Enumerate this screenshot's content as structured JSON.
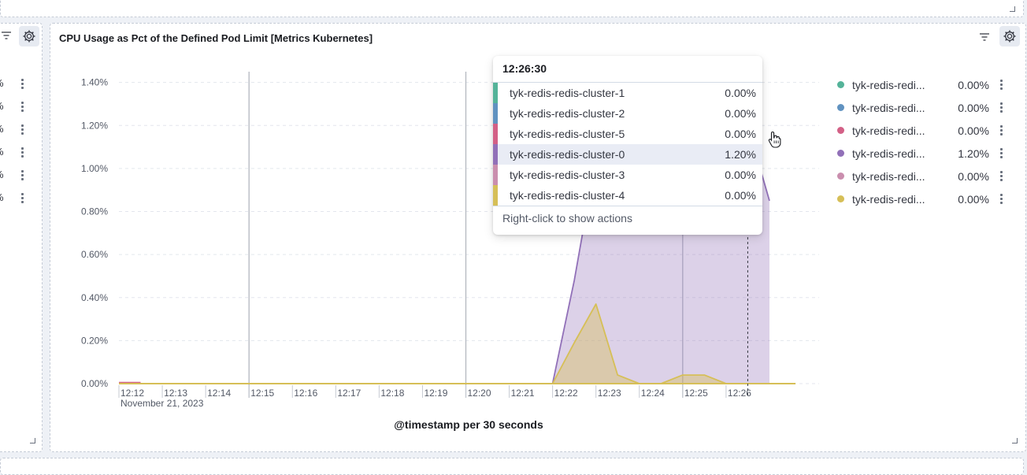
{
  "panel": {
    "title": "CPU Usage as Pct of the Defined Pod Limit [Metrics Kubernetes]"
  },
  "left_panel": {
    "values": [
      "%",
      "%",
      "%",
      "%",
      "%",
      "%"
    ]
  },
  "tooltip": {
    "time": "12:26:30",
    "rows": [
      {
        "name": "tyk-redis-redis-cluster-1",
        "value": "0.00%",
        "color": "#54b399"
      },
      {
        "name": "tyk-redis-redis-cluster-2",
        "value": "0.00%",
        "color": "#6092c0"
      },
      {
        "name": "tyk-redis-redis-cluster-5",
        "value": "0.00%",
        "color": "#d36086"
      },
      {
        "name": "tyk-redis-redis-cluster-0",
        "value": "1.20%",
        "color": "#9170b8",
        "highlighted": true
      },
      {
        "name": "tyk-redis-redis-cluster-3",
        "value": "0.00%",
        "color": "#ca8eae"
      },
      {
        "name": "tyk-redis-redis-cluster-4",
        "value": "0.00%",
        "color": "#d6bf57"
      }
    ],
    "footer": "Right-click to show actions"
  },
  "legend": [
    {
      "label": "tyk-redis-redi...",
      "value": "0.00%",
      "color": "#54b399"
    },
    {
      "label": "tyk-redis-redi...",
      "value": "0.00%",
      "color": "#6092c0"
    },
    {
      "label": "tyk-redis-redi...",
      "value": "0.00%",
      "color": "#d36086"
    },
    {
      "label": "tyk-redis-redi...",
      "value": "1.20%",
      "color": "#9170b8"
    },
    {
      "label": "tyk-redis-redi...",
      "value": "0.00%",
      "color": "#ca8eae"
    },
    {
      "label": "tyk-redis-redi...",
      "value": "0.00%",
      "color": "#d6bf57"
    }
  ],
  "chart_data": {
    "type": "area",
    "xlabel": "@timestamp per 30 seconds",
    "x_date_label": "November 21, 2023",
    "x_ticks": [
      "12:12",
      "12:13",
      "12:14",
      "12:15",
      "12:16",
      "12:17",
      "12:18",
      "12:19",
      "12:20",
      "12:21",
      "12:22",
      "12:23",
      "12:24",
      "12:25",
      "12:26"
    ],
    "x_range_minutes": [
      0,
      15.6
    ],
    "y_ticks": [
      "0.00%",
      "0.20%",
      "0.40%",
      "0.60%",
      "0.80%",
      "1.00%",
      "1.20%",
      "1.40%"
    ],
    "ylim": [
      0,
      1.45
    ],
    "grid": true,
    "legend_position": "right",
    "hover_time_minutes": 14.5,
    "series": [
      {
        "name": "tyk-redis-redis-cluster-0",
        "color": "#9170b8",
        "x": [
          10,
          10.5,
          11,
          11.5,
          12,
          12.5,
          13,
          13.5,
          14,
          14.5,
          15
        ],
        "y": [
          0,
          0.48,
          1.05,
          1.2,
          1.25,
          1.28,
          1.3,
          1.2,
          0.98,
          1.2,
          0.85
        ]
      },
      {
        "name": "tyk-redis-redis-cluster-4",
        "color": "#d6bf57",
        "x": [
          0,
          10,
          10.5,
          11,
          11.5,
          12,
          12.5,
          13,
          13.5,
          14,
          14.5,
          15
        ],
        "y": [
          0,
          0,
          0.19,
          0.37,
          0.04,
          0,
          0,
          0.04,
          0.04,
          0,
          0,
          0
        ]
      },
      {
        "name": "tyk-redis-redis-cluster-5",
        "color": "#d36086",
        "x": [
          0,
          0.5
        ],
        "y": [
          0.005,
          0.005
        ]
      }
    ]
  }
}
